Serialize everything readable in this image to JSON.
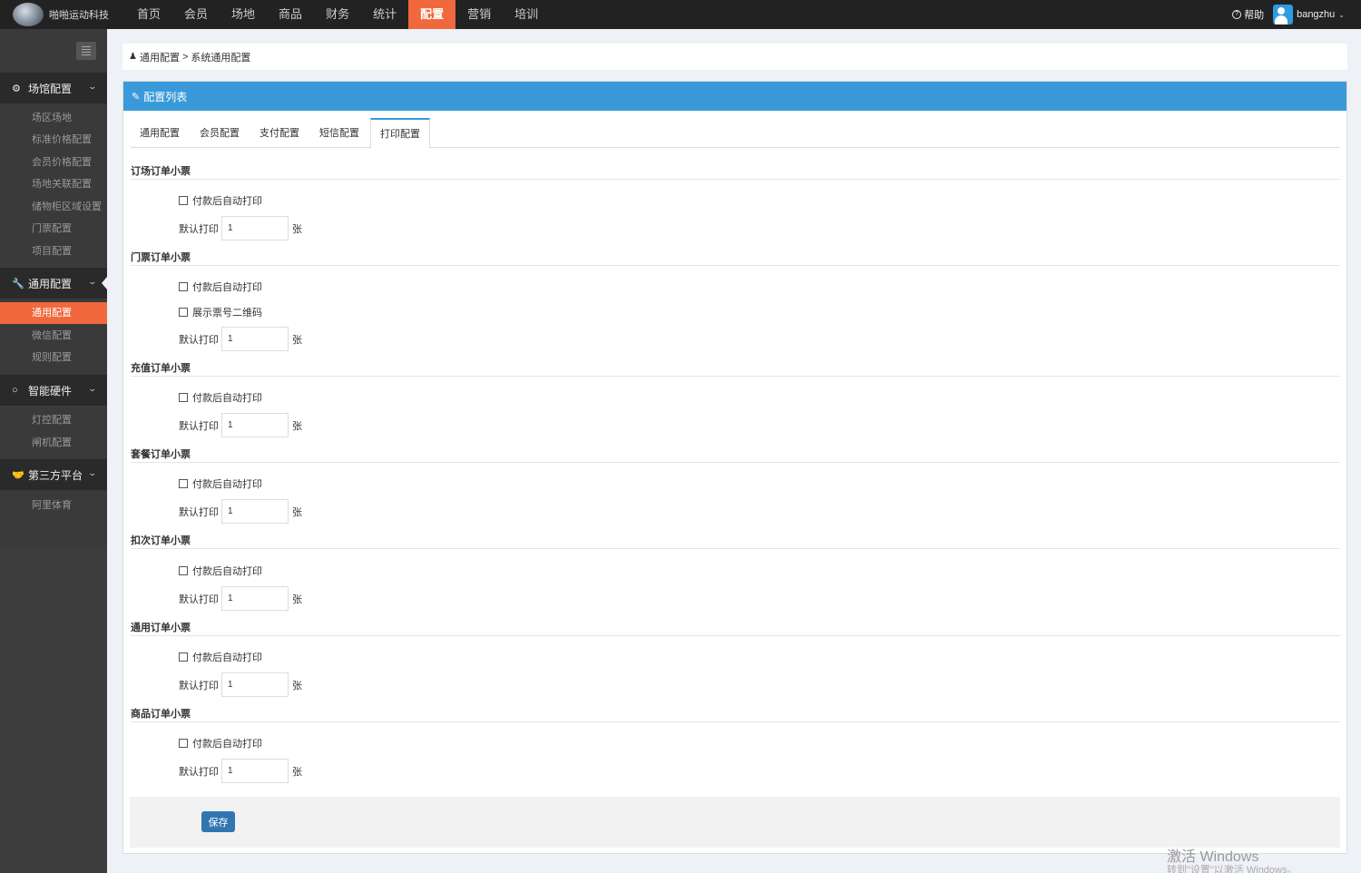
{
  "app": {
    "brand_name": "啪啪运动科技",
    "nav": [
      "首页",
      "会员",
      "场地",
      "商品",
      "财务",
      "统计",
      "配置",
      "营销",
      "培训"
    ],
    "nav_active_index": 6,
    "help_label": "帮助",
    "username": "bangzhu"
  },
  "sidebar": {
    "sections": [
      {
        "icon": "gears-icon",
        "label": "场馆配置",
        "items": [
          "场区场地",
          "标准价格配置",
          "会员价格配置",
          "场地关联配置",
          "储物柜区域设置",
          "门票配置",
          "项目配置"
        ]
      },
      {
        "icon": "wrench-icon",
        "label": "通用配置",
        "items": [
          "通用配置",
          "微信配置",
          "规则配置"
        ]
      },
      {
        "icon": "circle-icon",
        "label": "智能硬件",
        "items": [
          "灯控配置",
          "闸机配置"
        ]
      },
      {
        "icon": "handshake-icon",
        "label": "第三方平台",
        "items": [
          "阿里体育"
        ]
      }
    ]
  },
  "breadcrumb": {
    "part1": "通用配置",
    "sep": ">",
    "part2": "系统通用配置"
  },
  "panel": {
    "title": "配置列表",
    "tabs": [
      "通用配置",
      "会员配置",
      "支付配置",
      "短信配置",
      "打印配置"
    ],
    "active_tab_index": 4
  },
  "labels": {
    "auto_print": "付款后自动打印",
    "show_qr": "展示票号二维码",
    "default_print": "默认打印",
    "unit": "张"
  },
  "receipts": [
    {
      "title": "订场订单小票",
      "default_copies": "1",
      "auto_print": false
    },
    {
      "title": "门票订单小票",
      "default_copies": "1",
      "auto_print": false,
      "show_qr": false
    },
    {
      "title": "充值订单小票",
      "default_copies": "1",
      "auto_print": false
    },
    {
      "title": "套餐订单小票",
      "default_copies": "1",
      "auto_print": false
    },
    {
      "title": "扣次订单小票",
      "default_copies": "1",
      "auto_print": false
    },
    {
      "title": "通用订单小票",
      "default_copies": "1",
      "auto_print": false
    },
    {
      "title": "商品订单小票",
      "default_copies": "1",
      "auto_print": false
    }
  ],
  "save_label": "保存",
  "watermark": {
    "line1": "激活 Windows",
    "line2": "转到\"设置\"以激活 Windows。"
  }
}
